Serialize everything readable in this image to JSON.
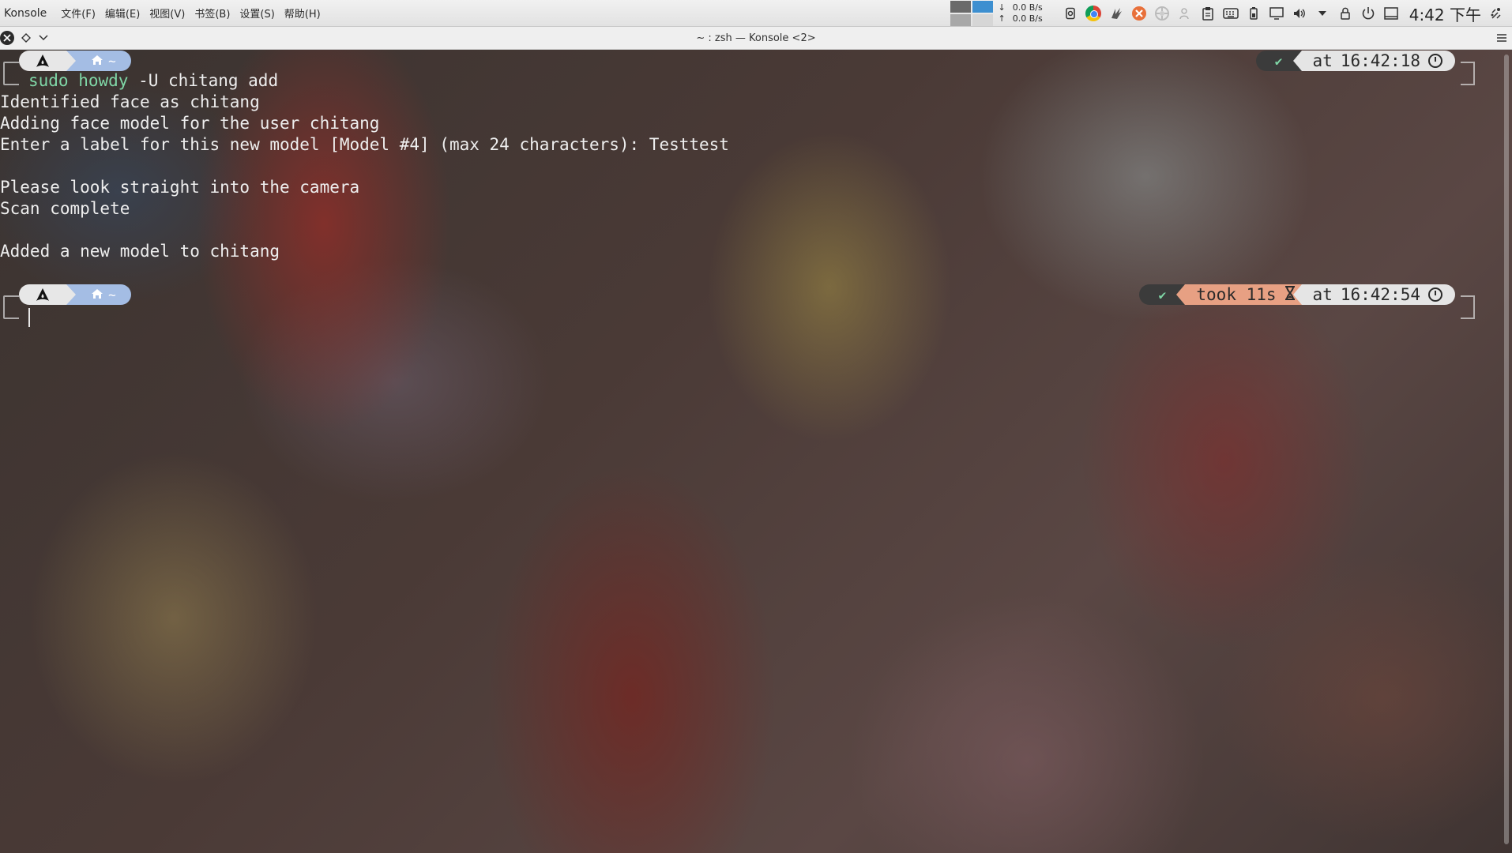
{
  "topbar": {
    "app_name": "Konsole",
    "menu": [
      "文件(F)",
      "编辑(E)",
      "视图(V)",
      "书签(B)",
      "设置(S)",
      "帮助(H)"
    ],
    "net_down_arrow": "↓",
    "net_up_arrow": "↑",
    "net_down": "0.0 B/s",
    "net_up": "0.0 B/s",
    "clock": "4:42 下午"
  },
  "window": {
    "title": "~ : zsh — Konsole <2>"
  },
  "terminal": {
    "prompt1": {
      "dir": "~",
      "status": "✔",
      "time_prefix": "at",
      "time": "16:42:18"
    },
    "command_green": "sudo howdy",
    "command_rest": " -U chitang add",
    "output": [
      "Identified face as chitang",
      "Adding face model for the user chitang",
      "Enter a label for this new model [Model #4] (max 24 characters): Testtest",
      "",
      "Please look straight into the camera",
      "Scan complete",
      "",
      "Added a new model to chitang"
    ],
    "prompt2": {
      "dir": "~",
      "status": "✔",
      "took": "took 11s",
      "time_prefix": "at",
      "time": "16:42:54"
    }
  },
  "icons": {
    "tray": [
      "chrome-icon",
      "kdeconnect-icon",
      "app-blocked-icon",
      "settings-wheel-icon",
      "user-icon",
      "clipboard-icon",
      "keyboard-icon",
      "battery-icon",
      "display-icon",
      "volume-icon",
      "expand-tray-icon",
      "lock-icon",
      "power-icon",
      "show-desktop-icon"
    ]
  }
}
